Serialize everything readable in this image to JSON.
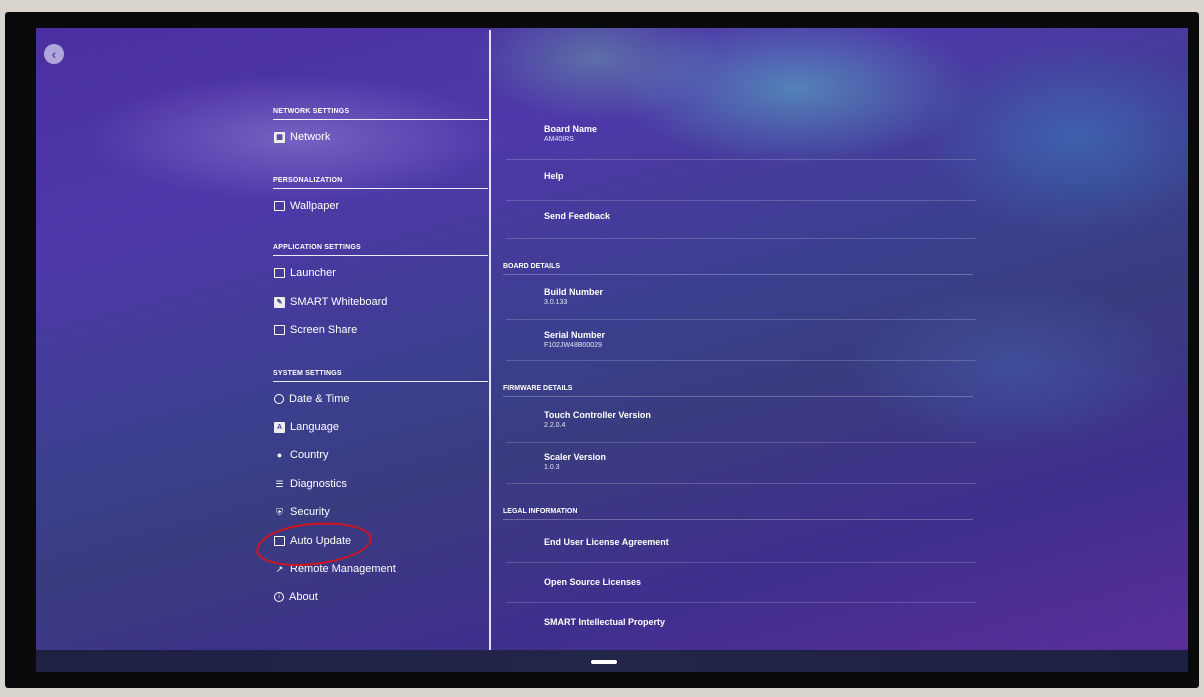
{
  "nav": {
    "back_icon": "chevron-left-icon"
  },
  "left_menu": {
    "sections": [
      {
        "heading": "NETWORK SETTINGS",
        "items": [
          {
            "label": "Network",
            "icon": "network-icon"
          }
        ]
      },
      {
        "heading": "PERSONALIZATION",
        "items": [
          {
            "label": "Wallpaper",
            "icon": "wallpaper-icon"
          }
        ]
      },
      {
        "heading": "APPLICATION SETTINGS",
        "items": [
          {
            "label": "Launcher",
            "icon": "launcher-icon"
          },
          {
            "label": "SMART Whiteboard",
            "icon": "whiteboard-icon"
          },
          {
            "label": "Screen Share",
            "icon": "cast-icon"
          }
        ]
      },
      {
        "heading": "SYSTEM SETTINGS",
        "items": [
          {
            "label": "Date & Time",
            "icon": "clock-icon"
          },
          {
            "label": "Language",
            "icon": "language-icon"
          },
          {
            "label": "Country",
            "icon": "location-pin-icon"
          },
          {
            "label": "Diagnostics",
            "icon": "list-icon"
          },
          {
            "label": "Security",
            "icon": "shield-icon"
          },
          {
            "label": "Auto Update",
            "icon": "update-icon"
          },
          {
            "label": "Remote Management",
            "icon": "wrench-icon"
          },
          {
            "label": "About",
            "icon": "info-icon"
          }
        ]
      }
    ]
  },
  "right_panel": {
    "top_items": [
      {
        "title": "Board Name",
        "value": "AM40IRS"
      },
      {
        "title": "Help",
        "value": ""
      },
      {
        "title": "Send Feedback",
        "value": ""
      }
    ],
    "board_details": {
      "heading": "BOARD DETAILS",
      "items": [
        {
          "title": "Build Number",
          "value": "3.0.133"
        },
        {
          "title": "Serial Number",
          "value": "F102JW48B00029"
        }
      ]
    },
    "firmware_details": {
      "heading": "FIRMWARE DETAILS",
      "items": [
        {
          "title": "Touch Controller Version",
          "value": "2.2.0.4"
        },
        {
          "title": "Scaler Version",
          "value": "1.0.3"
        }
      ]
    },
    "legal_information": {
      "heading": "LEGAL INFORMATION",
      "items": [
        {
          "title": "End User License Agreement"
        },
        {
          "title": "Open Source Licenses"
        },
        {
          "title": "SMART Intellectual Property"
        }
      ]
    }
  },
  "colors": {
    "annotation": "#d4141c",
    "background_start": "#4a2fa0",
    "background_end": "#5a2e9c"
  }
}
